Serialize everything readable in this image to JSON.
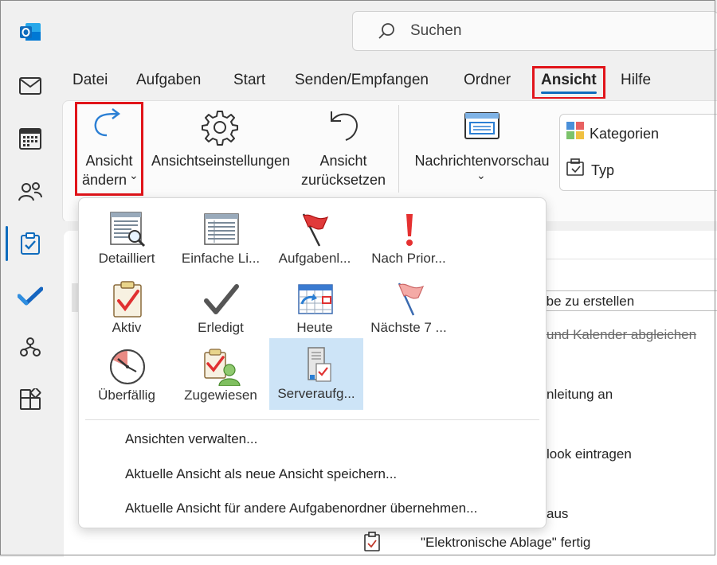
{
  "search": {
    "placeholder": "Suchen"
  },
  "menu": {
    "items": [
      "Datei",
      "Aufgaben",
      "Start",
      "Senden/Empfangen",
      "Ordner",
      "Ansicht",
      "Hilfe"
    ]
  },
  "ribbon": {
    "change_view": {
      "line1": "Ansicht",
      "line2": "ändern",
      "chevron": "⌄"
    },
    "view_settings": "Ansichtseinstellungen",
    "reset_view": {
      "line1": "Ansicht",
      "line2": "zurücksetzen"
    },
    "message_preview": {
      "label": "Nachrichtenvorschau",
      "chevron": "⌄"
    },
    "categories": "Kategorien",
    "type": "Typ"
  },
  "dropdown": {
    "views": [
      {
        "label": "Detailliert",
        "icon": "detailed-list-icon"
      },
      {
        "label": "Einfache Li...",
        "icon": "simple-list-icon"
      },
      {
        "label": "Aufgabenl...",
        "icon": "red-flag-icon"
      },
      {
        "label": "Nach Prior...",
        "icon": "exclamation-icon"
      },
      {
        "label": "Aktiv",
        "icon": "clipboard-check-icon"
      },
      {
        "label": "Erledigt",
        "icon": "checkmark-icon"
      },
      {
        "label": "Heute",
        "icon": "calendar-arrow-icon"
      },
      {
        "label": "Nächste 7 ...",
        "icon": "pink-flag-icon"
      },
      {
        "label": "Überfällig",
        "icon": "clock-icon"
      },
      {
        "label": "Zugewiesen",
        "icon": "assigned-person-icon"
      },
      {
        "label": "Serveraufg...",
        "icon": "server-task-icon",
        "selected": true
      }
    ],
    "links": [
      "Ansichten verwalten...",
      "Aktuelle Ansicht als neue Ansicht speichern...",
      "Aktuelle Ansicht für andere Aufgabenordner übernehmen..."
    ]
  },
  "tasks": [
    "fgabe zu erstellen",
    "und Kalender abgleichen",
    "nleitung an",
    "look eintragen",
    "aus",
    "\"Elektronische Ablage\" fertig"
  ],
  "colors": {
    "accent": "#0f6cbd",
    "highlight_box": "#e1141a",
    "selected_bg": "#cde4f7"
  }
}
